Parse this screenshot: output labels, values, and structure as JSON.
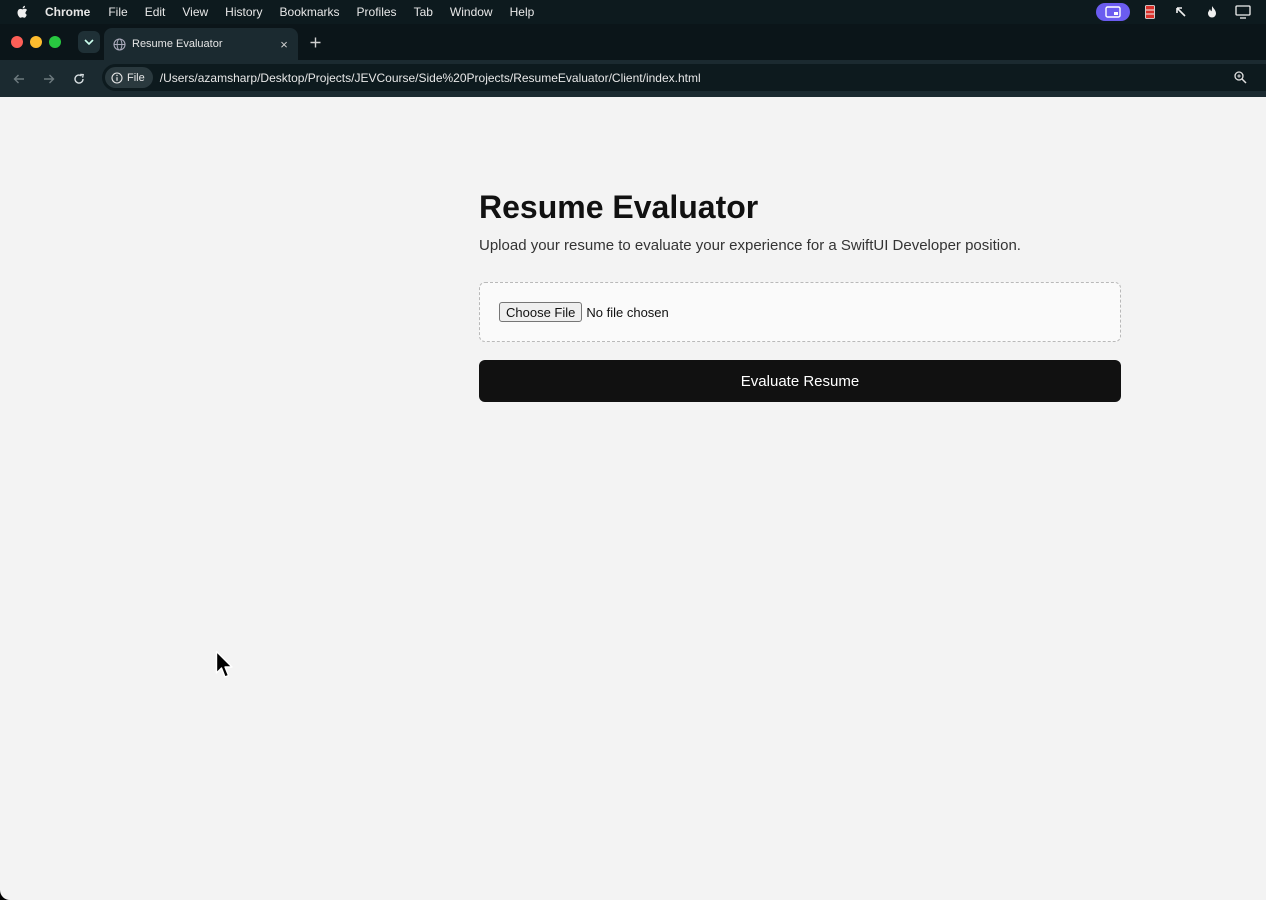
{
  "menubar": {
    "app_name": "Chrome",
    "items": [
      "File",
      "Edit",
      "View",
      "History",
      "Bookmarks",
      "Profiles",
      "Tab",
      "Window",
      "Help"
    ]
  },
  "tab": {
    "title": "Resume Evaluator",
    "close_symbol": "×"
  },
  "toolbar": {
    "scheme_chip": "File",
    "url": "/Users/azamsharp/Desktop/Projects/JEVCourse/Side%20Projects/ResumeEvaluator/Client/index.html"
  },
  "page": {
    "title": "Resume Evaluator",
    "subtitle": "Upload your resume to evaluate your experience for a SwiftUI Developer position.",
    "choose_file_label": "Choose File",
    "file_status": "No file chosen",
    "evaluate_label": "Evaluate Resume"
  },
  "colors": {
    "page_bg": "#f3f3f3",
    "button_bg": "#111111",
    "chrome_dark": "#0b1519"
  }
}
